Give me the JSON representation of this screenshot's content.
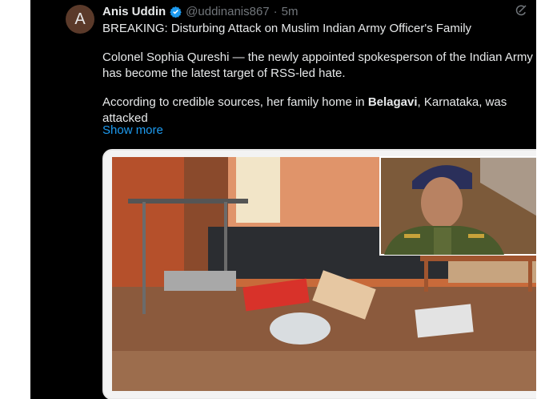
{
  "tweet": {
    "avatar_letter": "A",
    "author_name": "Anis Uddin",
    "handle": "@uddinanis867",
    "separator": "·",
    "time": "5m",
    "more_icon": "···",
    "line1": "BREAKING: Disturbing Attack on Muslim Indian Army Officer's Family",
    "para2": "Colonel Sophia Qureshi — the newly appointed spokesperson of the Indian Army — has become the latest target of RSS-led hate.",
    "para3_start": "According to credible sources, her family home in ",
    "para3_bold": "Belagavi",
    "para3_end": ", Karnataka, was attacked",
    "show_more": "Show more"
  },
  "colors": {
    "background": "#000000",
    "text": "#e7e9ea",
    "muted": "#71767b",
    "link": "#1d9bf0",
    "verified": "#1d9bf0"
  },
  "icons": [
    "verified-badge-icon",
    "grok-icon",
    "more-options-icon"
  ]
}
